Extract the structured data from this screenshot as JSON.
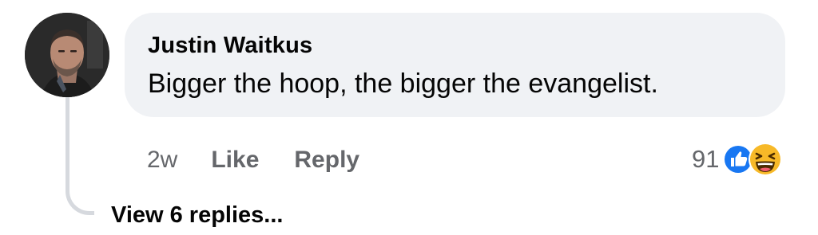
{
  "comment": {
    "author": "Justin Waitkus",
    "text": "Bigger the hoop, the bigger the evangelist.",
    "timestamp": "2w",
    "actions": {
      "like_label": "Like",
      "reply_label": "Reply"
    },
    "reactions": {
      "count": "91",
      "icons": [
        "like-reaction-icon",
        "haha-reaction-icon"
      ]
    },
    "view_replies_label": "View 6 replies..."
  },
  "colors": {
    "bubble_background": "#f0f2f5",
    "primary_text": "#050505",
    "secondary_text": "#65676b",
    "like_blue": "#1877f2",
    "haha_yellow": "#f7b928",
    "thread_line": "#d6d9de"
  }
}
